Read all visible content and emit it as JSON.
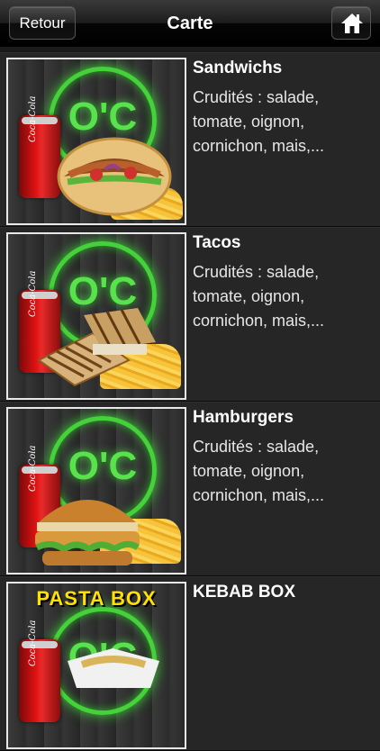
{
  "navbar": {
    "back_label": "Retour",
    "title": "Carte",
    "home_icon": "home-icon"
  },
  "items": [
    {
      "title": "Sandwichs",
      "description": "Crudités : salade, tomate, oignon, cornichon, mais,...",
      "thumbnail": {
        "logo": "O'C",
        "can_label": "Coca-Cola",
        "food": "sandwich"
      }
    },
    {
      "title": "Tacos",
      "description": "Crudités : salade, tomate, oignon, cornichon, mais,...",
      "thumbnail": {
        "logo": "O'C",
        "can_label": "Coca-Cola",
        "food": "tacos"
      }
    },
    {
      "title": "Hamburgers",
      "description": "Crudités : salade, tomate, oignon, cornichon, mais,...",
      "thumbnail": {
        "logo": "O'C",
        "can_label": "Coca-Cola",
        "food": "hamburger"
      }
    },
    {
      "title": "KEBAB BOX",
      "description": "",
      "thumbnail": {
        "logo": "O'C",
        "can_label": "Coca-Cola",
        "banner": "PASTA BOX",
        "food": "box"
      }
    }
  ],
  "colors": {
    "logo_green": "#45d13a",
    "banner_yellow": "#ffe000",
    "row_bg": "#262626"
  }
}
